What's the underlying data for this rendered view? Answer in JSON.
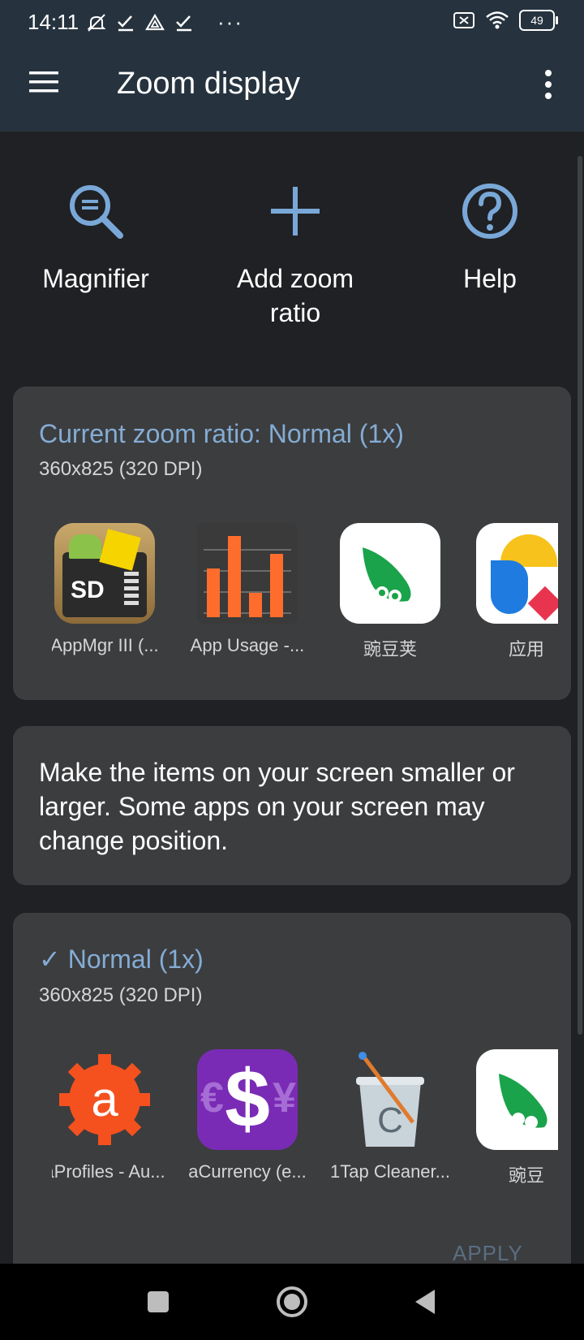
{
  "status_bar": {
    "time": "14:11",
    "left_icons": [
      "mute-icon",
      "check-icon",
      "drive-icon",
      "check-icon"
    ],
    "overflow": "···",
    "battery": "49"
  },
  "app_bar": {
    "title": "Zoom display"
  },
  "actions": [
    {
      "label": "Magnifier",
      "icon": "magnifier-icon"
    },
    {
      "label": "Add zoom ratio",
      "icon": "plus-icon"
    },
    {
      "label": "Help",
      "icon": "help-icon"
    }
  ],
  "current_card": {
    "title": "Current zoom ratio: Normal (1x)",
    "subtitle": "360x825 (320 DPI)",
    "apps": [
      {
        "label": "AppMgr III (..."
      },
      {
        "label": "App Usage -..."
      },
      {
        "label": "豌豆荚"
      },
      {
        "label": "应用"
      }
    ]
  },
  "description": {
    "text": "Make the items on your screen smaller or larger. Some apps on your screen may change position."
  },
  "option_card": {
    "check": "✓",
    "title": "Normal (1x)",
    "subtitle": "360x825 (320 DPI)",
    "apps": [
      {
        "label": "aProfiles - Au..."
      },
      {
        "label": "aCurrency (e..."
      },
      {
        "label": "1Tap Cleaner..."
      },
      {
        "label": "豌豆"
      }
    ],
    "apply_label": "APPLY"
  },
  "colors": {
    "accent": "#84acd4",
    "card": "#3c3d3f",
    "background": "#202124",
    "appbar": "#26333f"
  }
}
